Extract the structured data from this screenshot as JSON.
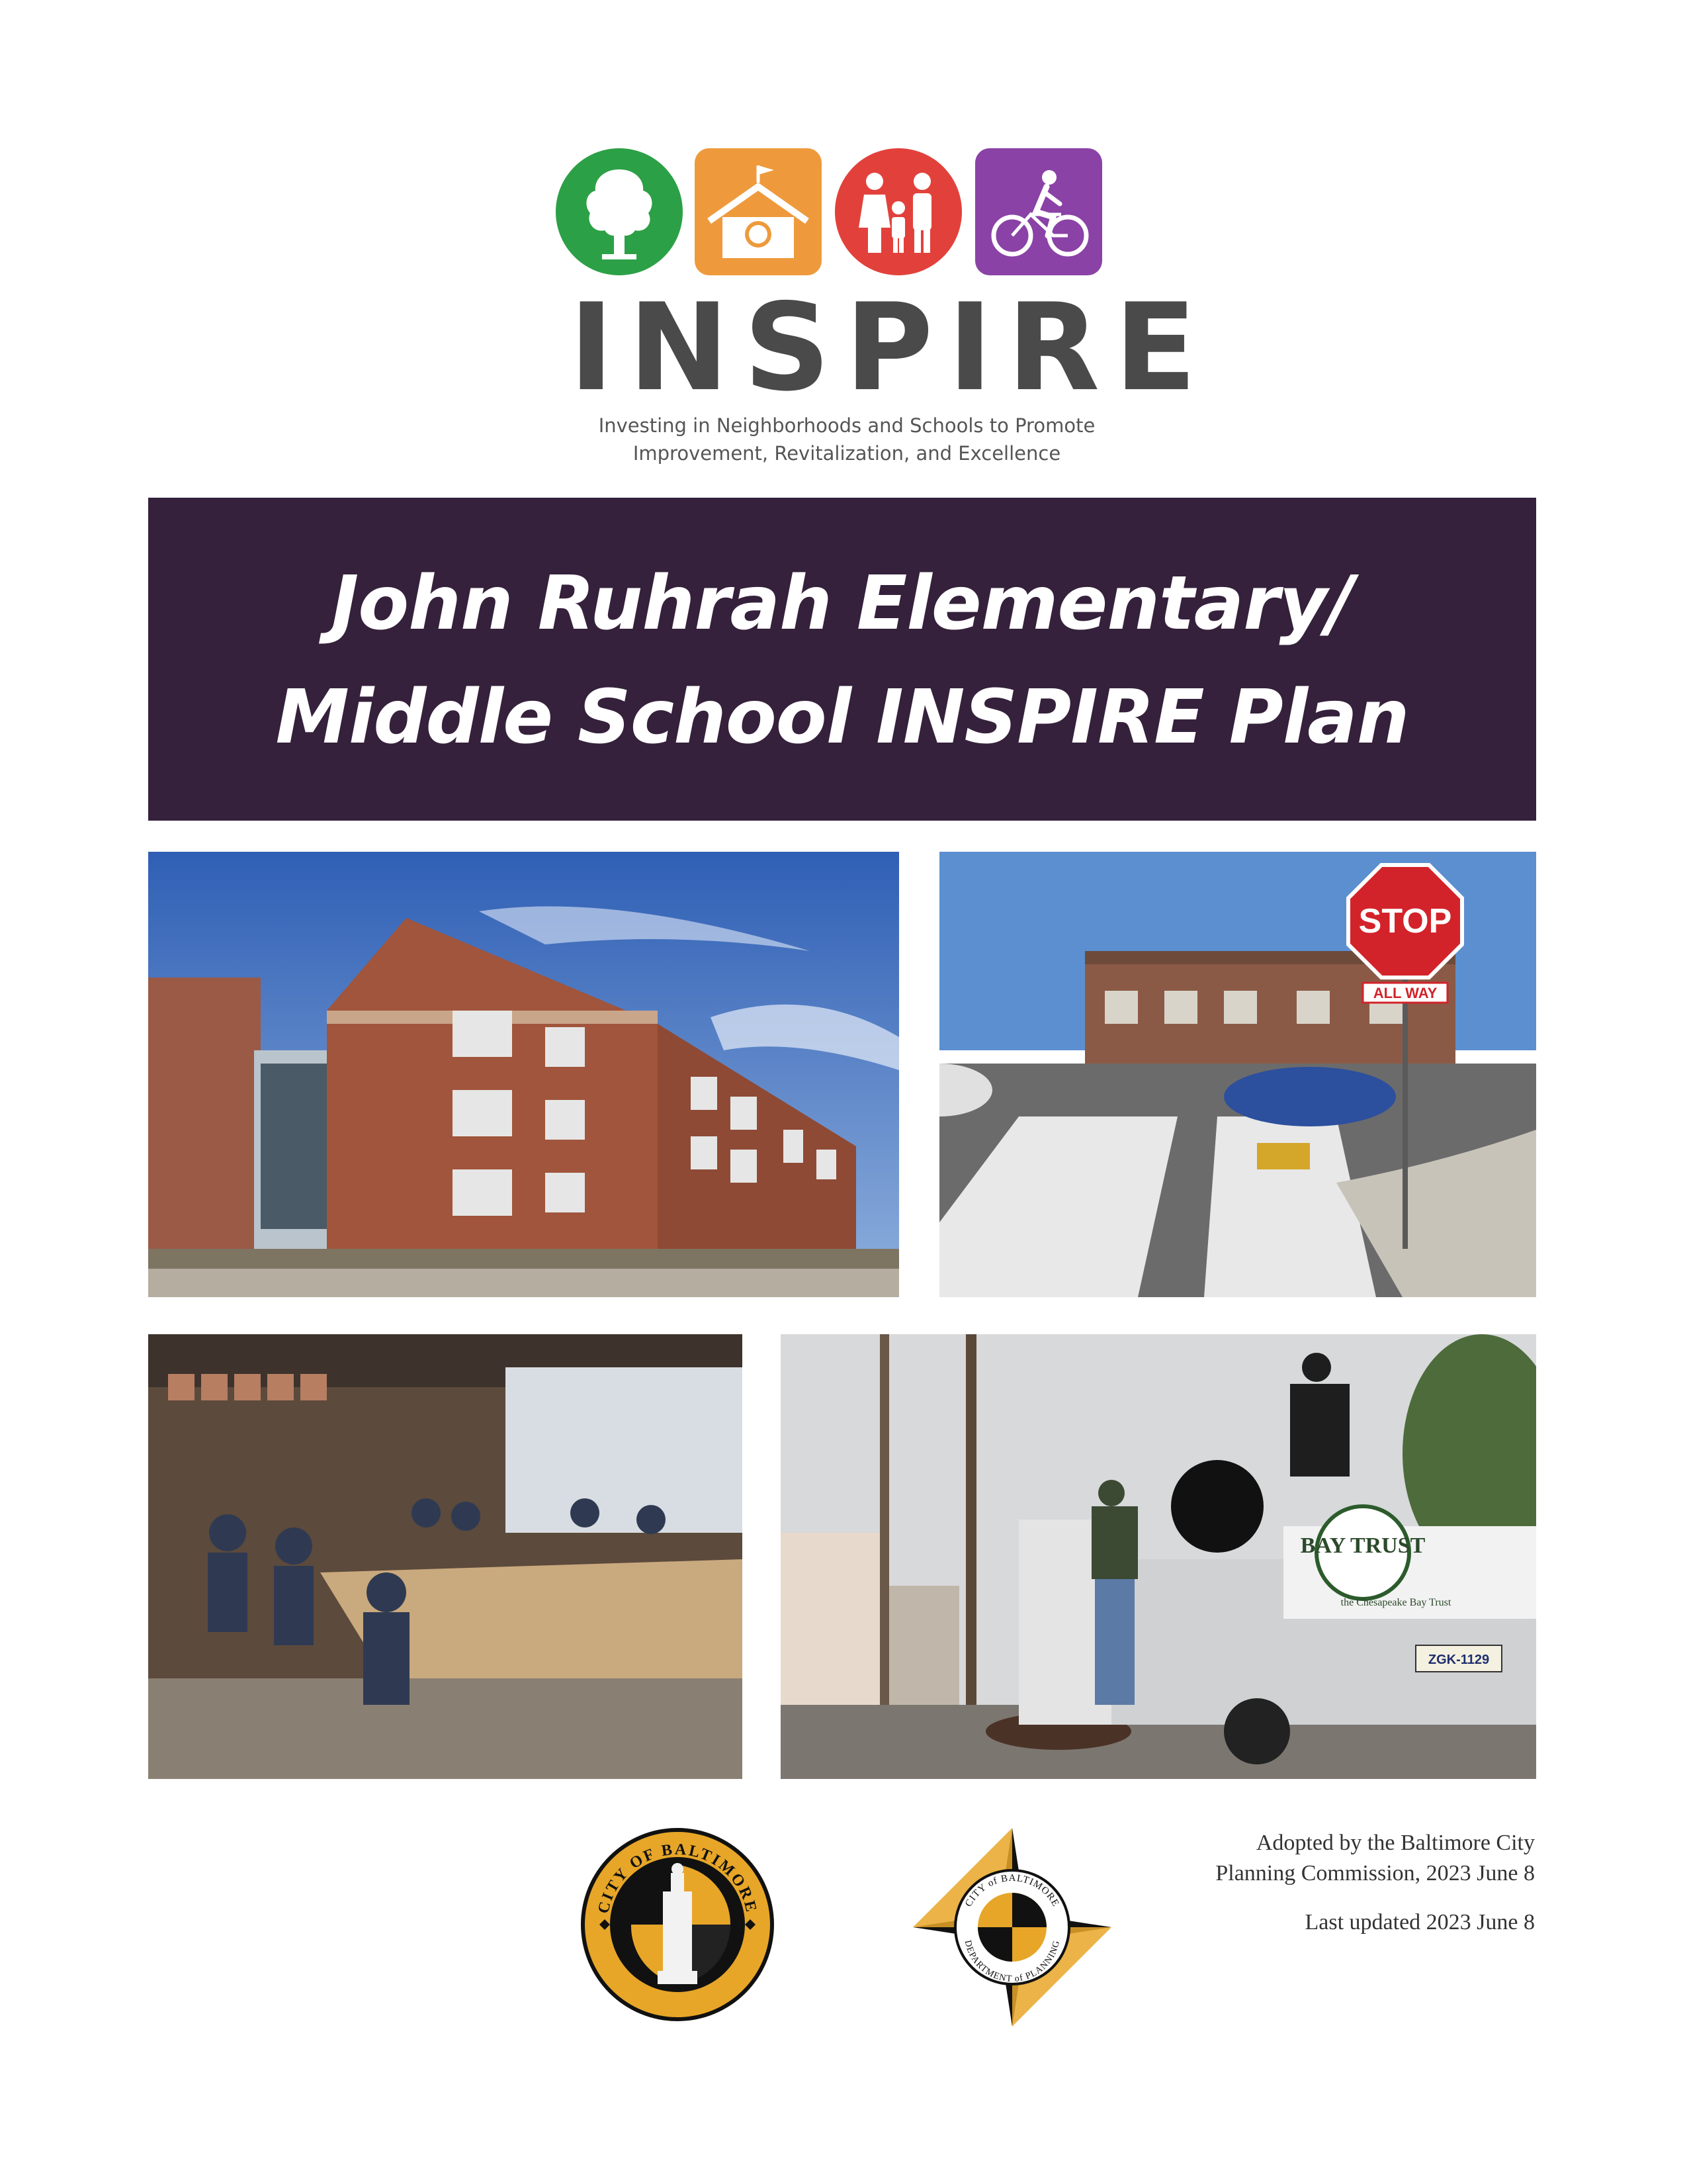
{
  "logo": {
    "icons": [
      "tree-icon",
      "schoolhouse-icon",
      "family-icon",
      "bicycle-icon"
    ],
    "colors": {
      "tree": "#2ca046",
      "school": "#ee9a3c",
      "family": "#e2413b",
      "bike": "#8a42a6"
    },
    "wordmark": "INSPIRE",
    "tagline_line1": "Investing in Neighborhoods and Schools to Promote",
    "tagline_line2": "Improvement, Revitalization, and Excellence"
  },
  "banner": {
    "title_line1": "John Ruhrah Elementary/",
    "title_line2": "Middle School INSPIRE Plan",
    "background": "#35213b"
  },
  "photos": {
    "school_sign_text": "",
    "street_stop_sign": "STOP",
    "street_all_way_sign": "ALL WAY",
    "truck_banner_text": "BAY TRUST",
    "truck_banner_subtext": "the Chesapeake Bay Trust",
    "truck_plate": "ZGK-1129"
  },
  "seals": {
    "city_seal_text": "CITY OF BALTIMORE",
    "dept_seal_text_top": "CITY of BALTIMORE",
    "dept_seal_text_bottom": "DEPARTMENT of PLANNING"
  },
  "adoption": {
    "line1": "Adopted by the Baltimore City",
    "line2": "Planning Commission, 2023 June 8",
    "line3": "Last updated 2023 June 8"
  }
}
